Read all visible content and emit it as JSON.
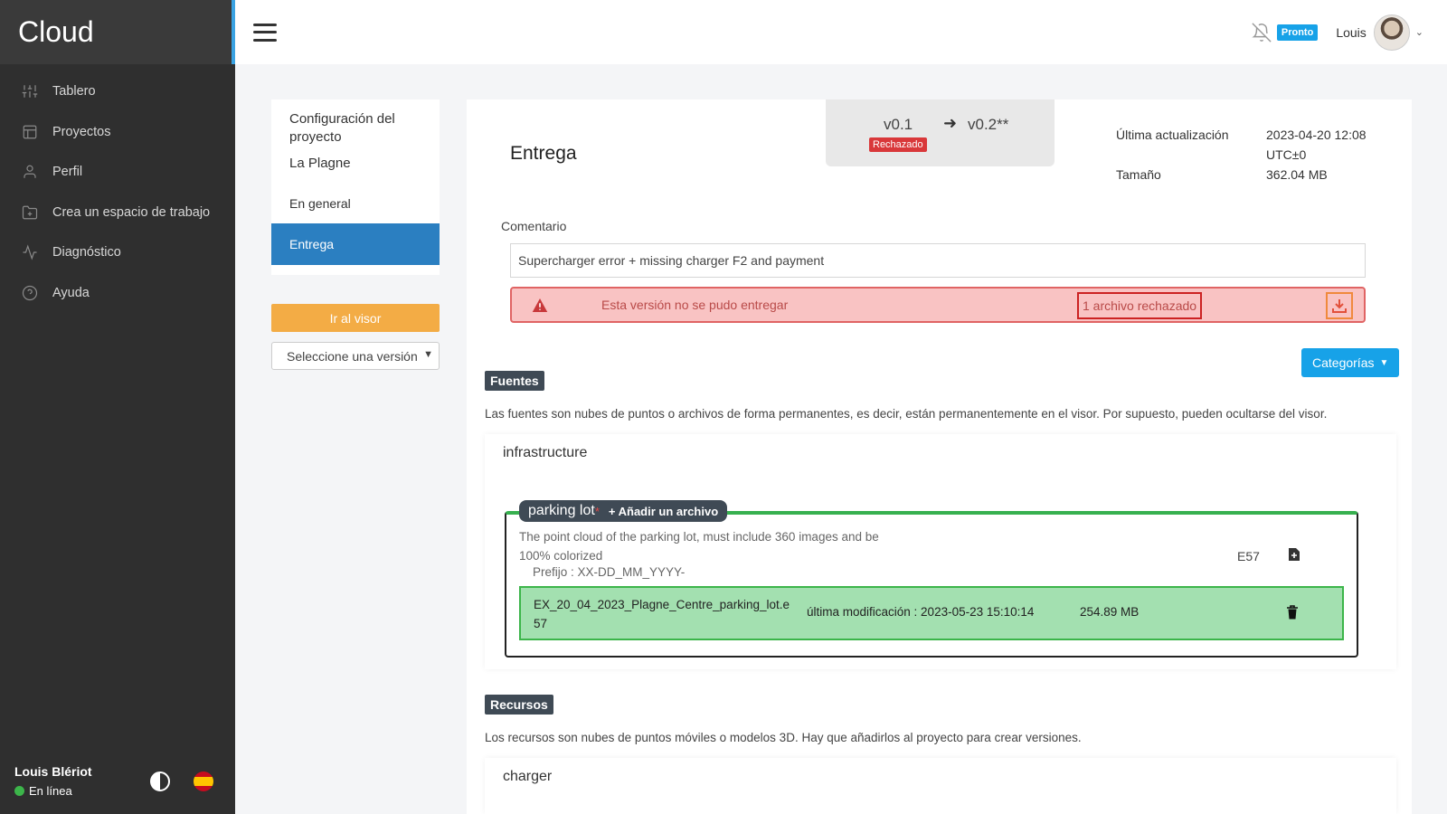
{
  "app": {
    "brand": "Cloud"
  },
  "sidebar": {
    "items": [
      {
        "label": "Tablero",
        "icon": "sliders-icon"
      },
      {
        "label": "Proyectos",
        "icon": "layout-icon"
      },
      {
        "label": "Perfil",
        "icon": "user-icon"
      },
      {
        "label": "Crea un espacio de trabajo",
        "icon": "folder-plus-icon"
      },
      {
        "label": "Diagnóstico",
        "icon": "activity-icon"
      },
      {
        "label": "Ayuda",
        "icon": "help-circle-icon"
      }
    ],
    "user_name": "Louis Blériot",
    "user_status": "En línea",
    "status_color": "#3cb54a"
  },
  "topbar": {
    "badge": "Pronto",
    "user": "Louis"
  },
  "settings": {
    "title": "Configuración del proyecto",
    "project": "La Plagne",
    "menu": [
      "En general",
      "Entrega"
    ],
    "active": "Entrega",
    "viewer_button": "Ir al visor",
    "version_select": "Seleccione una versión"
  },
  "delivery": {
    "title": "Entrega",
    "version_from": "v0.1",
    "version_to": "v0.2**",
    "status_badge": "Rechazado",
    "last_update_label": "Última actualización",
    "last_update_value": "2023-04-20 12:08 UTC±0",
    "size_label": "Tamaño",
    "size_value": "362.04 MB",
    "comment_label": "Comentario",
    "comment_value": "Supercharger error + missing charger F2 and payment",
    "alert_text": "Esta versión no se pudo entregar",
    "alert_link": "1 archivo rechazado",
    "categories_button": "Categorías"
  },
  "sources": {
    "tag": "Fuentes",
    "description": "Las fuentes son nubes de puntos o archivos de forma permanentes, es decir, están permanentemente en el visor. Por supuesto, pueden ocultarse del visor.",
    "group_title": "infrastructure",
    "slot": {
      "name": "parking lot",
      "required_mark": "*",
      "add_label": "+ Añadir un archivo",
      "description": "The point cloud of the parking lot, must include 360 images and be 100% colorized",
      "prefix": "Prefijo : XX-DD_MM_YYYY-",
      "format": "E57",
      "file": {
        "name": "EX_20_04_2023_Plagne_Centre_parking_lot.e57",
        "modified": "última modificación : 2023-05-23 15:10:14",
        "size": "254.89 MB"
      }
    }
  },
  "resources": {
    "tag": "Recursos",
    "description": "Los recursos son nubes de puntos móviles o modelos 3D. Hay que añadirlos al proyecto para crear versiones.",
    "group_title": "charger"
  }
}
